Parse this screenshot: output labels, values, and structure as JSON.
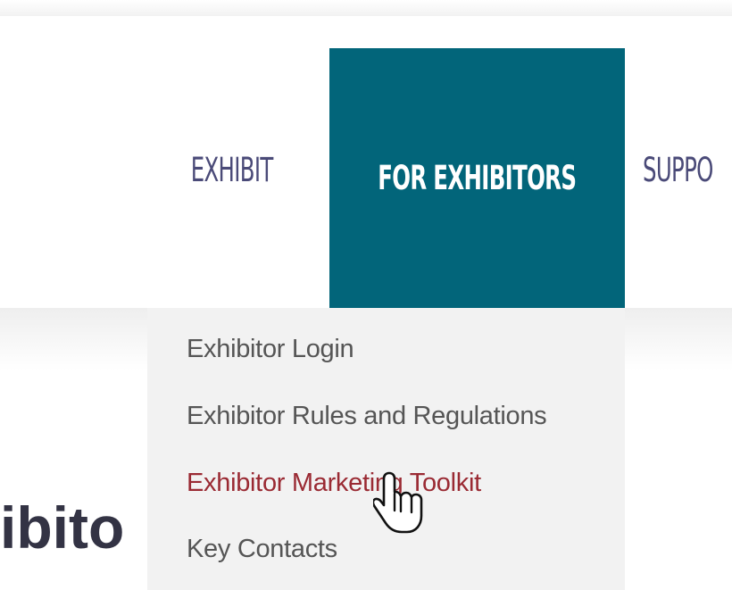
{
  "nav": {
    "items": [
      {
        "label": "EXHIBIT"
      },
      {
        "label": "FOR EXHIBITORS",
        "active": true
      },
      {
        "label": "SUPPO"
      }
    ]
  },
  "dropdown": {
    "items": [
      {
        "label": "Exhibitor Login"
      },
      {
        "label": "Exhibitor Rules and Regulations"
      },
      {
        "label": "Exhibitor Marketing Toolkit",
        "hovered": true
      },
      {
        "label": "Key Contacts"
      }
    ]
  },
  "page": {
    "heading_fragment": "ibito"
  },
  "cursor": {
    "icon": "hand-pointer-icon"
  },
  "colors": {
    "active_nav_bg": "#02657a",
    "nav_text": "#4a4a78",
    "dropdown_bg": "#f2f2f2",
    "dropdown_text": "#555555",
    "hover_text": "#9a2a33"
  }
}
